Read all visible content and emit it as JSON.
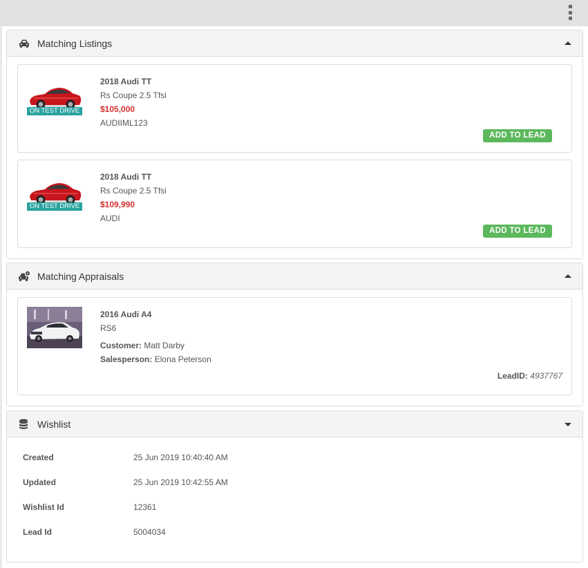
{
  "listings_panel": {
    "title": "Matching Listings",
    "items": [
      {
        "badge": "ON TEST DRIVE",
        "title": "2018 Audi TT",
        "variant": "Rs Coupe 2.5 Tfsi",
        "price": "$105,000",
        "stock": "AUDIIML123",
        "button": "ADD TO LEAD"
      },
      {
        "badge": "ON TEST DRIVE",
        "title": "2018 Audi TT",
        "variant": "Rs Coupe 2.5 Tfsi",
        "price": "$109,990",
        "stock": "AUDI",
        "button": "ADD TO LEAD"
      }
    ]
  },
  "appraisals_panel": {
    "title": "Matching Appraisals",
    "item": {
      "title": "2016 Audi A4",
      "variant": "RS6",
      "customer_label": "Customer:",
      "customer": "Matt Darby",
      "salesperson_label": "Salesperson:",
      "salesperson": "Elona Peterson",
      "lead_id_label": "LeadID:",
      "lead_id": "4937767"
    }
  },
  "wishlist_panel": {
    "title": "Wishlist",
    "rows": [
      {
        "label": "Created",
        "value": "25 Jun 2019 10:40:40 AM"
      },
      {
        "label": "Updated",
        "value": "25 Jun 2019 10:42:55 AM"
      },
      {
        "label": "Wishlist Id",
        "value": "12361"
      },
      {
        "label": "Lead Id",
        "value": "5004034"
      }
    ]
  },
  "icons": {
    "menu": "kebab-menu-icon",
    "listings": "car-icon",
    "appraisals": "car-appraisal-icon",
    "wishlist": "database-icon",
    "collapse": "caret-up-icon",
    "expand": "caret-down-icon"
  },
  "colors": {
    "price": "#d32f2f",
    "badge": "#2aa3a0",
    "add_button": "#5cb85c",
    "header_bg": "#f4f4f4",
    "topbar_bg": "#e1e1e1"
  }
}
